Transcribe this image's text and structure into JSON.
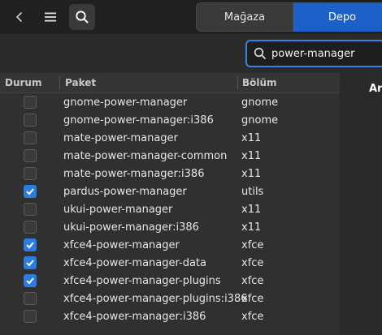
{
  "header": {
    "tabs": [
      {
        "label": "Mağaza",
        "active": false
      },
      {
        "label": "Depo",
        "active": true
      }
    ]
  },
  "search": {
    "value": "power-manager"
  },
  "right_panel": {
    "label": "Ara"
  },
  "table": {
    "columns": [
      "Durum",
      "Paket",
      "Bölüm"
    ],
    "rows": [
      {
        "checked": false,
        "package": "gnome-power-manager",
        "section": "gnome"
      },
      {
        "checked": false,
        "package": "gnome-power-manager:i386",
        "section": "gnome"
      },
      {
        "checked": false,
        "package": "mate-power-manager",
        "section": "x11"
      },
      {
        "checked": false,
        "package": "mate-power-manager-common",
        "section": "x11"
      },
      {
        "checked": false,
        "package": "mate-power-manager:i386",
        "section": "x11"
      },
      {
        "checked": true,
        "package": "pardus-power-manager",
        "section": "utils"
      },
      {
        "checked": false,
        "package": "ukui-power-manager",
        "section": "x11"
      },
      {
        "checked": false,
        "package": "ukui-power-manager:i386",
        "section": "x11"
      },
      {
        "checked": true,
        "package": "xfce4-power-manager",
        "section": "xfce"
      },
      {
        "checked": true,
        "package": "xfce4-power-manager-data",
        "section": "xfce"
      },
      {
        "checked": true,
        "package": "xfce4-power-manager-plugins",
        "section": "xfce"
      },
      {
        "checked": false,
        "package": "xfce4-power-manager-plugins:i386",
        "section": "xfce"
      },
      {
        "checked": false,
        "package": "xfce4-power-manager:i386",
        "section": "xfce"
      }
    ]
  },
  "colors": {
    "accent": "#1c61c7",
    "checkbox_on": "#2a7de1",
    "focus_border": "#3584e4"
  },
  "icons": [
    "back-icon",
    "menu-icon",
    "search-icon",
    "check-icon"
  ]
}
